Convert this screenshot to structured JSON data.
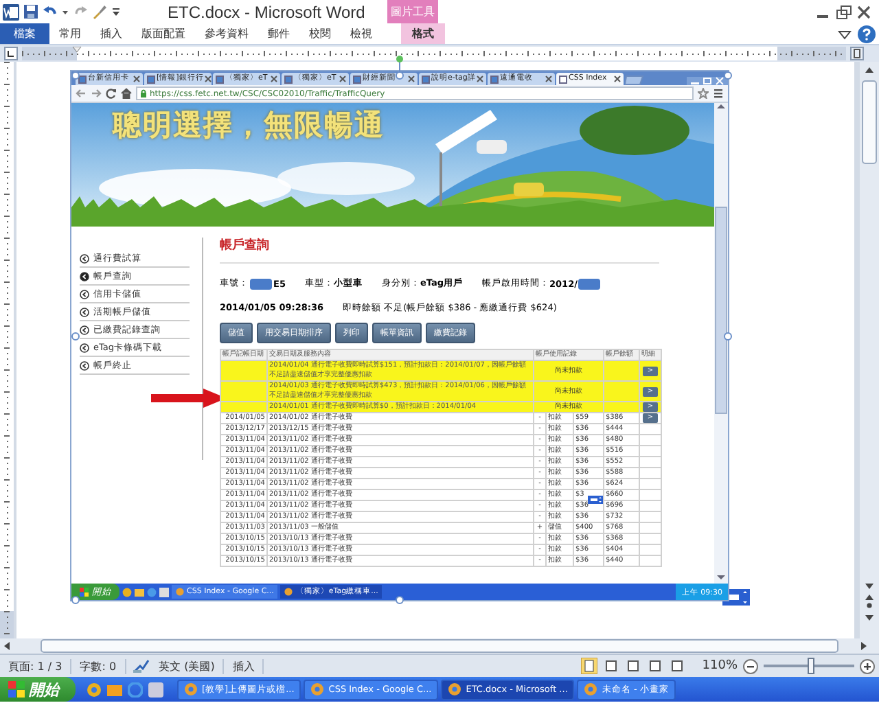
{
  "window": {
    "title": "ETC.docx - Microsoft Word",
    "context_header": "圖片工具"
  },
  "ribbon_tabs": [
    {
      "label": "檔案",
      "kind": "file",
      "selected": false
    },
    {
      "label": "常用",
      "kind": "normal",
      "selected": false
    },
    {
      "label": "插入",
      "kind": "normal",
      "selected": false
    },
    {
      "label": "版面配置",
      "kind": "normal",
      "selected": false
    },
    {
      "label": "參考資料",
      "kind": "normal",
      "selected": false
    },
    {
      "label": "郵件",
      "kind": "normal",
      "selected": false
    },
    {
      "label": "校閱",
      "kind": "normal",
      "selected": false
    },
    {
      "label": "檢視",
      "kind": "normal",
      "selected": false
    },
    {
      "label": "格式",
      "kind": "context",
      "selected": true
    }
  ],
  "document": {
    "image": {
      "browser_tabs": [
        {
          "label": "台新信用卡",
          "selected": false
        },
        {
          "label": "[情報]銀行行",
          "selected": false
        },
        {
          "label": "〈獨家〉eT",
          "selected": false
        },
        {
          "label": "〈獨家〉eT",
          "selected": false
        },
        {
          "label": "財經新聞",
          "selected": false
        },
        {
          "label": "說明e-tag詳",
          "selected": false
        },
        {
          "label": "遠通電收",
          "selected": false
        },
        {
          "label": "CSS Index",
          "selected": true
        }
      ],
      "address": "https://css.fetc.net.tw/CSC/CSC02010/Traffic/TrafficQuery",
      "banner": {
        "slogan": "聰明選擇，無限暢通"
      },
      "sidebar": [
        {
          "label": "通行費試算",
          "selected": false
        },
        {
          "label": "帳戶查詢",
          "selected": true
        },
        {
          "label": "信用卡儲值",
          "selected": false
        },
        {
          "label": "活期帳戶儲值",
          "selected": false
        },
        {
          "label": "已繳費記錄查詢",
          "selected": false
        },
        {
          "label": "eTag卡條碼下載",
          "selected": false
        },
        {
          "label": "帳戶終止",
          "selected": false
        }
      ],
      "page_title": "帳戶查詢",
      "info": [
        {
          "label": "車號：",
          "value": "E5",
          "masked_prefix": true
        },
        {
          "label": "車型：",
          "value": "小型車"
        },
        {
          "label": "身分別：",
          "value": "eTag用戶"
        },
        {
          "label": "帳戶啟用時間：",
          "value": "2012/",
          "masked_suffix": true
        }
      ],
      "timestamp": "2014/01/05 09:28:36",
      "balance_note": "即時餘額 不足(帳戶餘額 $386 - 應繳通行費 $624)",
      "buttons": [
        "儲值",
        "用交易日期排序",
        "列印",
        "帳單資訊",
        "繳費記錄"
      ],
      "table": {
        "columns": [
          "帳戶記帳日期",
          "交易日期及服務內容",
          "帳戶使用記錄",
          "帳戶餘額",
          "明細"
        ],
        "rows": [
          {
            "kind": "pending",
            "text": "2014/01/04 通行電子收費即時試算$151，預計扣款日：2014/01/07，因帳戶餘額不足請盡速儲值才享完整優惠扣款",
            "usage": "尚未扣款",
            "detail": ">"
          },
          {
            "kind": "pending",
            "text": "2014/01/03 通行電子收費即時試算$473，預計扣款日：2014/01/06，因帳戶餘額不足請盡速儲值才享完整優惠扣款",
            "usage": "尚未扣款",
            "detail": ">"
          },
          {
            "kind": "pending",
            "text": "2014/01/01 通行電子收費即時試算$0，預計扣款日：2014/01/04",
            "usage": "尚未扣款",
            "detail": ">"
          },
          {
            "kind": "entry",
            "date": "2014/01/05",
            "text": "2014/01/02 通行電子收費",
            "sign": "-",
            "type": "扣款",
            "amount": "$59",
            "balance": "$386",
            "detail": ">"
          },
          {
            "kind": "entry",
            "date": "2013/12/17",
            "text": "2013/12/15 通行電子收費",
            "sign": "-",
            "type": "扣款",
            "amount": "$36",
            "balance": "$444"
          },
          {
            "kind": "entry",
            "date": "2013/11/04",
            "text": "2013/11/02 通行電子收費",
            "sign": "-",
            "type": "扣款",
            "amount": "$36",
            "balance": "$480"
          },
          {
            "kind": "entry",
            "date": "2013/11/04",
            "text": "2013/11/02 通行電子收費",
            "sign": "-",
            "type": "扣款",
            "amount": "$36",
            "balance": "$516"
          },
          {
            "kind": "entry",
            "date": "2013/11/04",
            "text": "2013/11/02 通行電子收費",
            "sign": "-",
            "type": "扣款",
            "amount": "$36",
            "balance": "$552"
          },
          {
            "kind": "entry",
            "date": "2013/11/04",
            "text": "2013/11/02 通行電子收費",
            "sign": "-",
            "type": "扣款",
            "amount": "$36",
            "balance": "$588"
          },
          {
            "kind": "entry",
            "date": "2013/11/04",
            "text": "2013/11/02 通行電子收費",
            "sign": "-",
            "type": "扣款",
            "amount": "$36",
            "balance": "$624"
          },
          {
            "kind": "entry",
            "date": "2013/11/04",
            "text": "2013/11/02 通行電子收費",
            "sign": "-",
            "type": "扣款",
            "amount": "$3",
            "balance": "$660"
          },
          {
            "kind": "entry",
            "date": "2013/11/04",
            "text": "2013/11/02 通行電子收費",
            "sign": "-",
            "type": "扣款",
            "amount": "$36",
            "balance": "$696"
          },
          {
            "kind": "entry",
            "date": "2013/11/04",
            "text": "2013/11/02 通行電子收費",
            "sign": "-",
            "type": "扣款",
            "amount": "$36",
            "balance": "$732"
          },
          {
            "kind": "entry",
            "date": "2013/11/03",
            "text": "2013/11/03 一般儲值",
            "sign": "+",
            "type": "儲值",
            "amount": "$400",
            "balance": "$768"
          },
          {
            "kind": "entry",
            "date": "2013/10/15",
            "text": "2013/10/13 通行電子收費",
            "sign": "-",
            "type": "扣款",
            "amount": "$36",
            "balance": "$368"
          },
          {
            "kind": "entry",
            "date": "2013/10/15",
            "text": "2013/10/13 通行電子收費",
            "sign": "-",
            "type": "扣款",
            "amount": "$36",
            "balance": "$404"
          },
          {
            "kind": "entry",
            "date": "2013/10/15",
            "text": "2013/10/13 通行電子收費",
            "sign": "-",
            "type": "扣款",
            "amount": "$36",
            "balance": "$440"
          }
        ]
      },
      "taskbar": {
        "start": "開始",
        "tasks": [
          {
            "label": "CSS Index - Google C...",
            "selected": false
          },
          {
            "label": "〈獨家〉eTag繳稱車...",
            "selected": true
          }
        ],
        "clock": "上午 09:30"
      }
    }
  },
  "status_bar": {
    "items": [
      "頁面: 1 / 3",
      "字數: 0",
      "英文 (美國)",
      "插入"
    ],
    "zoom": "110%",
    "zoom_slider": {
      "level": 0.52
    }
  },
  "taskbar": {
    "start": "開始",
    "tasks": [
      {
        "label": "[教學]上傳圖片或檔...",
        "selected": false
      },
      {
        "label": "CSS Index - Google C...",
        "selected": false
      },
      {
        "label": "ETC.docx - Microsoft ...",
        "selected": true
      },
      {
        "label": "未命名 - 小畫家",
        "selected": false
      }
    ]
  }
}
